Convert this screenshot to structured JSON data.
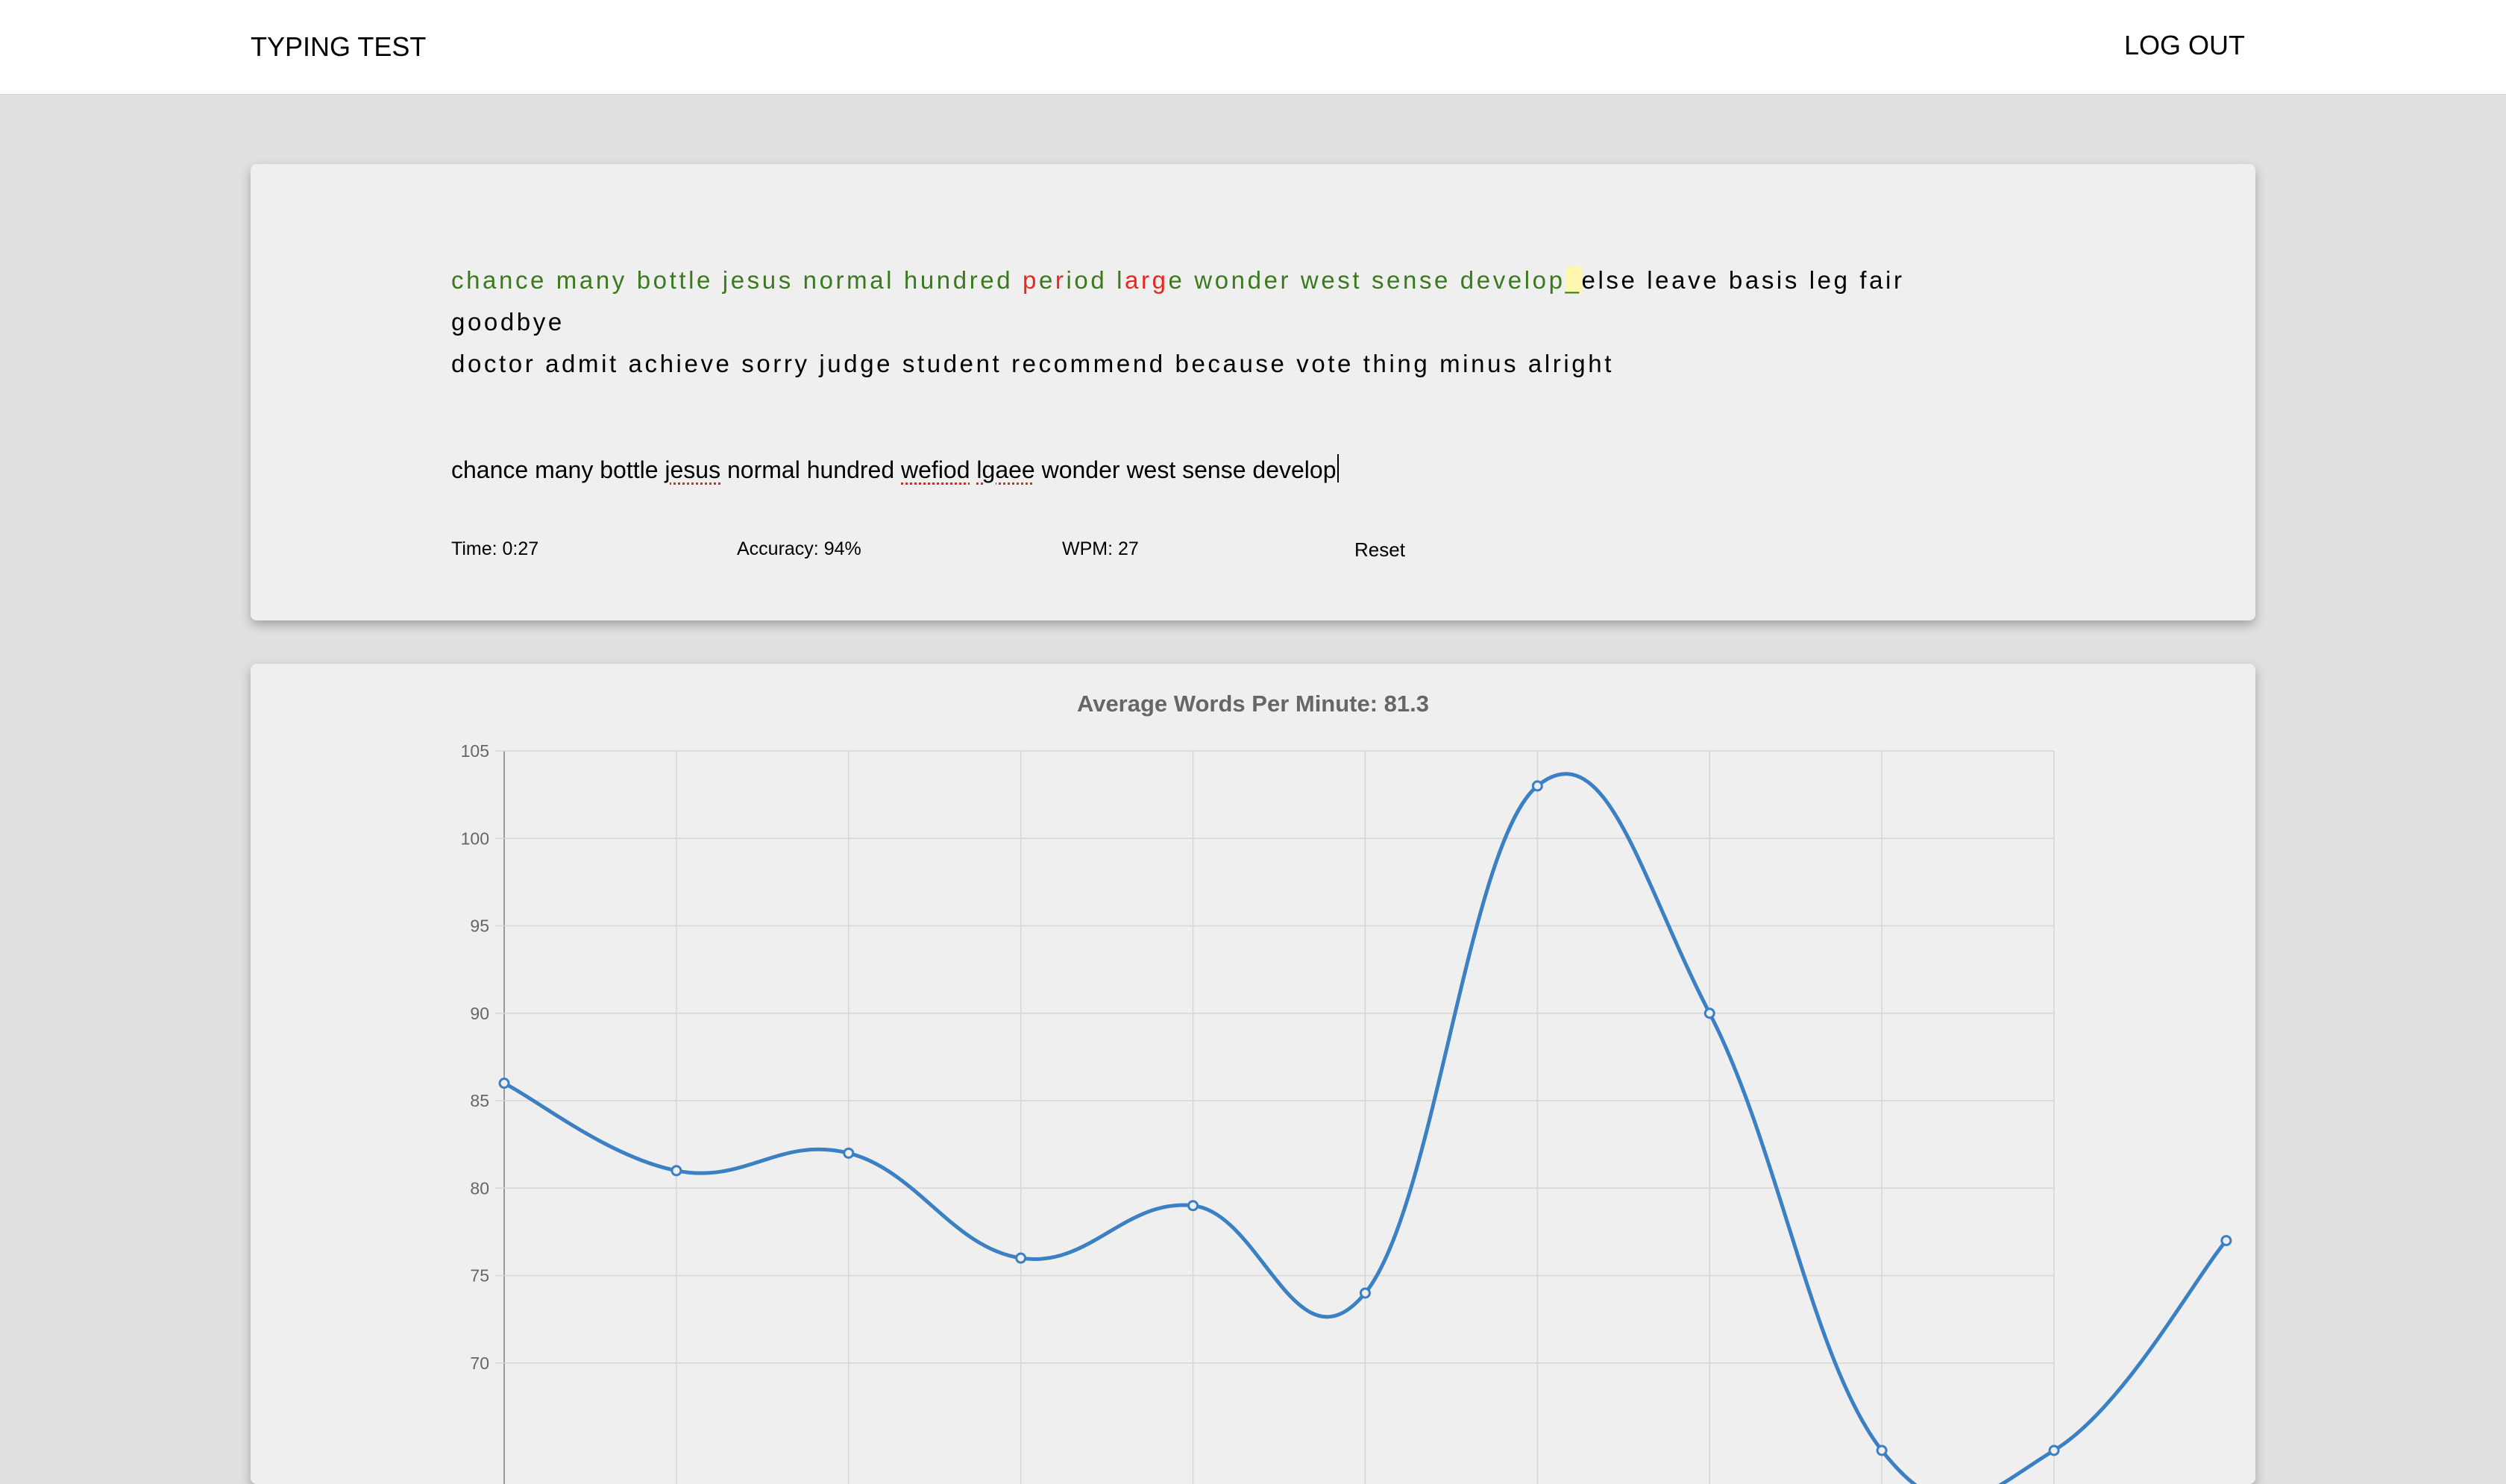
{
  "nav": {
    "brand": "TYPING TEST",
    "logout": "LOG OUT"
  },
  "test": {
    "prompt_words": [
      {
        "text": "chance",
        "state": "ok"
      },
      {
        "text": "many",
        "state": "ok"
      },
      {
        "text": "bottle",
        "state": "ok"
      },
      {
        "text": "jesus",
        "state": "ok"
      },
      {
        "text": "normal",
        "state": "ok"
      },
      {
        "text": "hundred",
        "state": "ok"
      },
      {
        "chars": [
          [
            "p",
            "bad"
          ],
          [
            "e",
            "ok"
          ],
          [
            "r",
            "bad"
          ],
          [
            "i",
            "ok"
          ],
          [
            "o",
            "ok"
          ],
          [
            "d",
            "ok"
          ]
        ]
      },
      {
        "chars": [
          [
            "l",
            "ok"
          ],
          [
            "a",
            "bad"
          ],
          [
            "r",
            "bad"
          ],
          [
            "g",
            "bad"
          ],
          [
            "e",
            "ok"
          ]
        ]
      },
      {
        "text": "wonder",
        "state": "ok"
      },
      {
        "text": "west",
        "state": "ok"
      },
      {
        "text": "sense",
        "state": "ok"
      },
      {
        "text": "develop",
        "state": "ok"
      }
    ],
    "cursor_char": "_",
    "remaining_line1": "else leave basis leg fair goodbye",
    "remaining_line2": "doctor admit achieve sorry judge student recommend because vote thing minus alright",
    "typed": {
      "before1": "chance many bottle ",
      "misspelled1": "jesus",
      "mid1": " normal hundred ",
      "misspelled2": "wefiod",
      "space": " ",
      "misspelled3": "lgaee",
      "after": " wonder west sense develop"
    },
    "stats": {
      "time": "Time: 0:27",
      "accuracy": "Accuracy: 94%",
      "wpm": "WPM: 27",
      "reset": "Reset"
    }
  },
  "chart_title": "Average Words Per Minute: 81.3",
  "chart_data": {
    "type": "line",
    "title": "Average Words Per Minute: 81.3",
    "x": [
      1,
      2,
      3,
      4,
      5,
      6,
      7,
      8,
      9,
      10,
      11
    ],
    "values": [
      86,
      81,
      82,
      76,
      79,
      74,
      103,
      90,
      65,
      65,
      77
    ],
    "ylim": [
      67,
      105
    ],
    "yticks": [
      105,
      100,
      95,
      90,
      85,
      80,
      75,
      70
    ],
    "grid": true,
    "line_color": "#3a80c2"
  }
}
